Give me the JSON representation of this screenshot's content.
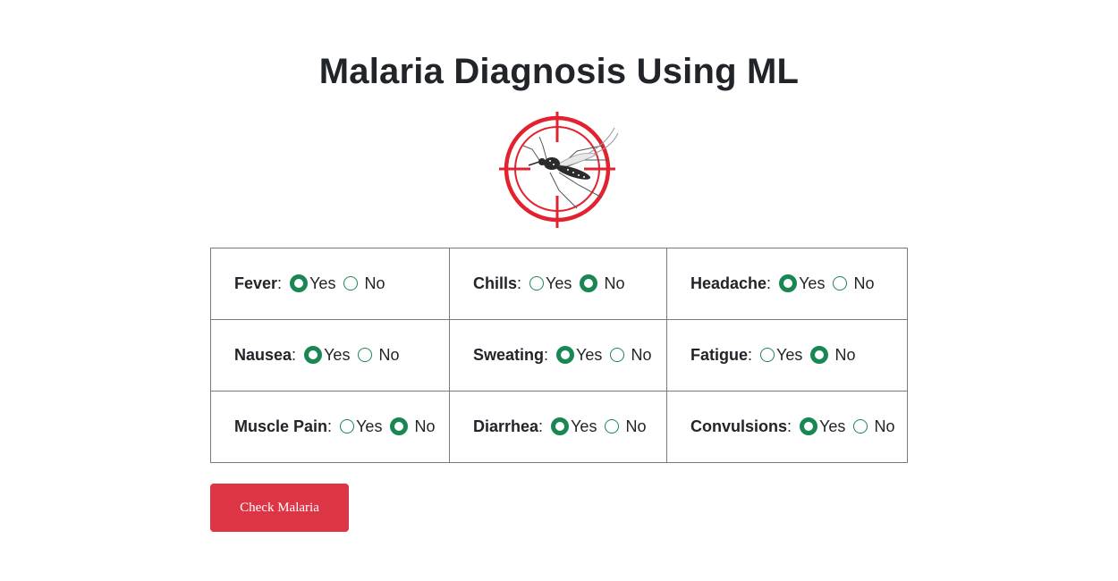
{
  "page": {
    "title": "Malaria Diagnosis Using ML"
  },
  "logo": {
    "icon": "mosquito-crosshair-icon",
    "accent_color": "#e2232f"
  },
  "form": {
    "option_yes": "Yes",
    "option_no": "No",
    "radio_color": "#198754",
    "symptoms": [
      {
        "label": "Fever",
        "selected": "Yes"
      },
      {
        "label": "Chills",
        "selected": "No"
      },
      {
        "label": "Headache",
        "selected": "Yes"
      },
      {
        "label": "Nausea",
        "selected": "Yes"
      },
      {
        "label": "Sweating",
        "selected": "Yes"
      },
      {
        "label": "Fatigue",
        "selected": "No"
      },
      {
        "label": "Muscle Pain",
        "selected": "No"
      },
      {
        "label": "Diarrhea",
        "selected": "Yes"
      },
      {
        "label": "Convulsions",
        "selected": "Yes"
      }
    ],
    "submit_label": "Check Malaria",
    "submit_color": "#dc3545"
  }
}
